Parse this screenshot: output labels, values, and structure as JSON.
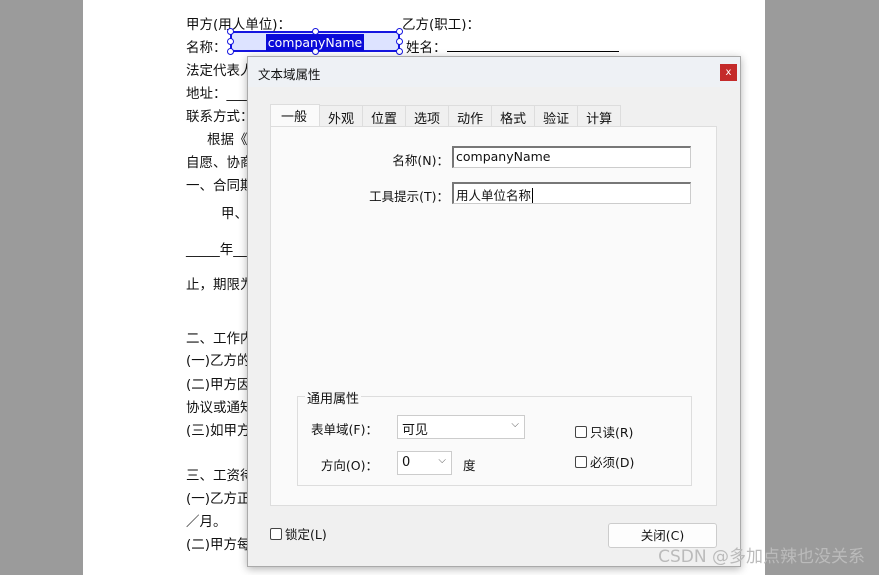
{
  "document": {
    "lines": [
      "甲方(用人单位)：",
      "名称：",
      "法定代表人",
      "地址：___",
      "联系方式：",
      "根据《",
      "自愿、协商",
      "一、合同期",
      "甲、",
      "_____年__",
      "止，期限为",
      "二、工作内",
      "(一)乙方的",
      "(二)甲方因",
      "协议或通知",
      "(三)如甲方",
      "三、工资待",
      "(一)乙方正",
      "／月。",
      "(二)甲方每"
    ],
    "party_b": "乙方(职工)：",
    "name_label": "姓名：",
    "selected_field": "companyName"
  },
  "dialog": {
    "title": "文本域属性",
    "close_x": "x",
    "tabs": [
      "一般",
      "外观",
      "位置",
      "选项",
      "动作",
      "格式",
      "验证",
      "计算"
    ],
    "active_tab": "一般",
    "name_label": "名称(N)：",
    "name_value": "companyName",
    "tooltip_label": "工具提示(T)：",
    "tooltip_value": "用人单位名称",
    "group_title": "通用属性",
    "form_field_label": "表单域(F)：",
    "form_field_value": "可见",
    "orientation_label": "方向(O)：",
    "orientation_value": "0",
    "degree": "度",
    "readonly": "只读(R)",
    "required": "必须(D)",
    "readonly_checked": false,
    "required_checked": false,
    "locked": "锁定(L)",
    "locked_checked": false,
    "close_button": "关闭(C)"
  },
  "watermark": "CSDN @多加点辣也没关系"
}
